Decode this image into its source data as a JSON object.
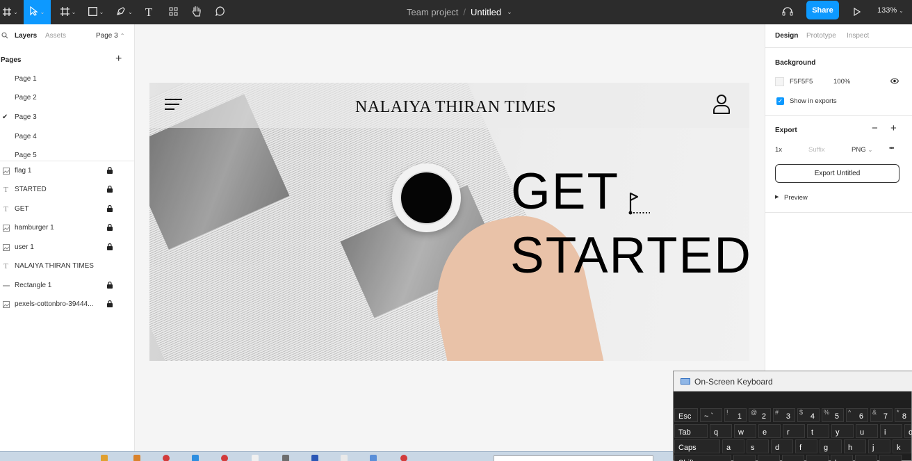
{
  "toolbar": {
    "project": "Team project",
    "separator": "/",
    "file_title": "Untitled",
    "share_label": "Share",
    "zoom": "133%",
    "text_tool_glyph": "T",
    "icons": [
      "main-menu-icon",
      "move-tool-icon",
      "frame-tool-icon",
      "shape-tool-icon",
      "pen-tool-icon",
      "text-tool-icon",
      "resources-icon",
      "hand-tool-icon",
      "comment-icon",
      "headphones-icon",
      "present-play-icon"
    ]
  },
  "left_panel": {
    "tabs": {
      "layers": "Layers",
      "assets": "Assets",
      "current_page": "Page 3"
    },
    "pages_heading": "Pages",
    "add_glyph": "+",
    "pages": [
      {
        "label": "Page 1",
        "active": false
      },
      {
        "label": "Page 2",
        "active": false
      },
      {
        "label": "Page 3",
        "active": true
      },
      {
        "label": "Page 4",
        "active": false
      },
      {
        "label": "Page 5",
        "active": false
      }
    ],
    "layers": [
      {
        "label": "flag 1",
        "icon": "image-icon",
        "locked": true
      },
      {
        "label": "STARTED",
        "icon": "text-icon",
        "locked": true
      },
      {
        "label": "GET",
        "icon": "text-icon",
        "locked": true
      },
      {
        "label": "hamburger 1",
        "icon": "image-icon",
        "locked": true
      },
      {
        "label": "user 1",
        "icon": "image-icon",
        "locked": true
      },
      {
        "label": "NALAIYA THIRAN TIMES",
        "icon": "text-icon",
        "locked": false
      },
      {
        "label": "Rectangle 1",
        "icon": "rectangle-icon",
        "locked": true
      },
      {
        "label": "pexels-cottonbro-39444...",
        "icon": "image-icon",
        "locked": true
      }
    ]
  },
  "canvas": {
    "brand": "NALAIYA THIRAN TIMES",
    "hero_line1": "GET",
    "hero_line2": "STARTED"
  },
  "right_panel": {
    "tabs": {
      "design": "Design",
      "prototype": "Prototype",
      "inspect": "Inspect"
    },
    "background_heading": "Background",
    "bg_hex": "F5F5F5",
    "bg_opacity": "100%",
    "show_in_exports": "Show in exports",
    "export_heading": "Export",
    "minus_glyph": "−",
    "plus_glyph": "+",
    "scale": "1x",
    "suffix_placeholder": "Suffix",
    "format": "PNG",
    "more_glyph": "•••",
    "export_button": "Export Untitled",
    "preview": "Preview"
  },
  "osk": {
    "title": "On-Screen Keyboard",
    "row1": [
      {
        "main": "Esc",
        "shift": ""
      },
      {
        "main": "~ `",
        "shift": ""
      },
      {
        "main": "1",
        "shift": "!"
      },
      {
        "main": "2",
        "shift": "@"
      },
      {
        "main": "3",
        "shift": "#"
      },
      {
        "main": "4",
        "shift": "$"
      },
      {
        "main": "5",
        "shift": "%"
      },
      {
        "main": "6",
        "shift": "^"
      },
      {
        "main": "7",
        "shift": "&"
      },
      {
        "main": "8",
        "shift": "*"
      }
    ],
    "row2": [
      "Tab",
      "q",
      "w",
      "e",
      "r",
      "t",
      "y",
      "u",
      "i",
      "o"
    ],
    "row3": [
      "Caps",
      "a",
      "s",
      "d",
      "f",
      "g",
      "h",
      "j",
      "k"
    ],
    "row4": [
      "Shift",
      "z",
      "x",
      "c",
      "v",
      "b",
      "n",
      "m"
    ]
  },
  "colors": {
    "accent": "#0d99ff",
    "toolbar_bg": "#2c2c2c",
    "canvas_bg": "#f5f5f5"
  }
}
